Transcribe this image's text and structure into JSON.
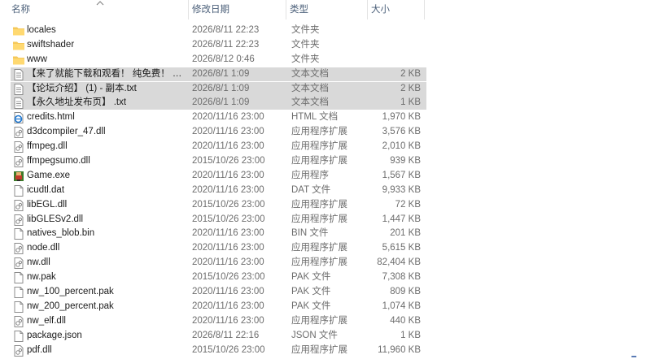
{
  "columns": {
    "name": "名称",
    "date": "修改日期",
    "type": "类型",
    "size": "大小"
  },
  "files": [
    {
      "name": "locales",
      "date": "2026/8/11 22:23",
      "type": "文件夹",
      "size": "",
      "icon": "folder-icon",
      "selected": false
    },
    {
      "name": "swiftshader",
      "date": "2026/8/11 22:23",
      "type": "文件夹",
      "size": "",
      "icon": "folder-icon",
      "selected": false
    },
    {
      "name": "www",
      "date": "2026/8/12 0:46",
      "type": "文件夹",
      "size": "",
      "icon": "folder-icon",
      "selected": false
    },
    {
      "name": "【来了就能下载和观看！ 纯免费！ 】 - 副...",
      "date": "2026/8/1 1:09",
      "type": "文本文档",
      "size": "2 KB",
      "icon": "text-document-icon",
      "selected": true
    },
    {
      "name": "【论坛介绍】 (1) - 副本.txt",
      "date": "2026/8/1 1:09",
      "type": "文本文档",
      "size": "2 KB",
      "icon": "text-document-icon",
      "selected": true
    },
    {
      "name": "【永久地址发布页】 .txt",
      "date": "2026/8/1 1:09",
      "type": "文本文档",
      "size": "1 KB",
      "icon": "text-document-icon",
      "selected": true
    },
    {
      "name": "credits.html",
      "date": "2020/11/16 23:00",
      "type": "HTML 文档",
      "size": "1,970 KB",
      "icon": "browser-icon",
      "selected": false
    },
    {
      "name": "d3dcompiler_47.dll",
      "date": "2020/11/16 23:00",
      "type": "应用程序扩展",
      "size": "3,576 KB",
      "icon": "dll-file-icon",
      "selected": false
    },
    {
      "name": "ffmpeg.dll",
      "date": "2020/11/16 23:00",
      "type": "应用程序扩展",
      "size": "2,010 KB",
      "icon": "dll-file-icon",
      "selected": false
    },
    {
      "name": "ffmpegsumo.dll",
      "date": "2015/10/26 23:00",
      "type": "应用程序扩展",
      "size": "939 KB",
      "icon": "dll-file-icon",
      "selected": false
    },
    {
      "name": "Game.exe",
      "date": "2020/11/16 23:00",
      "type": "应用程序",
      "size": "1,567 KB",
      "icon": "game-app-icon",
      "selected": false
    },
    {
      "name": "icudtl.dat",
      "date": "2020/11/16 23:00",
      "type": "DAT 文件",
      "size": "9,933 KB",
      "icon": "blank-file-icon",
      "selected": false
    },
    {
      "name": "libEGL.dll",
      "date": "2015/10/26 23:00",
      "type": "应用程序扩展",
      "size": "72 KB",
      "icon": "dll-file-icon",
      "selected": false
    },
    {
      "name": "libGLESv2.dll",
      "date": "2015/10/26 23:00",
      "type": "应用程序扩展",
      "size": "1,447 KB",
      "icon": "dll-file-icon",
      "selected": false
    },
    {
      "name": "natives_blob.bin",
      "date": "2020/11/16 23:00",
      "type": "BIN 文件",
      "size": "201 KB",
      "icon": "blank-file-icon",
      "selected": false
    },
    {
      "name": "node.dll",
      "date": "2020/11/16 23:00",
      "type": "应用程序扩展",
      "size": "5,615 KB",
      "icon": "dll-file-icon",
      "selected": false
    },
    {
      "name": "nw.dll",
      "date": "2020/11/16 23:00",
      "type": "应用程序扩展",
      "size": "82,404 KB",
      "icon": "dll-file-icon",
      "selected": false
    },
    {
      "name": "nw.pak",
      "date": "2015/10/26 23:00",
      "type": "PAK 文件",
      "size": "7,308 KB",
      "icon": "blank-file-icon",
      "selected": false
    },
    {
      "name": "nw_100_percent.pak",
      "date": "2020/11/16 23:00",
      "type": "PAK 文件",
      "size": "809 KB",
      "icon": "blank-file-icon",
      "selected": false
    },
    {
      "name": "nw_200_percent.pak",
      "date": "2020/11/16 23:00",
      "type": "PAK 文件",
      "size": "1,074 KB",
      "icon": "blank-file-icon",
      "selected": false
    },
    {
      "name": "nw_elf.dll",
      "date": "2020/11/16 23:00",
      "type": "应用程序扩展",
      "size": "440 KB",
      "icon": "dll-file-icon",
      "selected": false
    },
    {
      "name": "package.json",
      "date": "2026/8/11 22:16",
      "type": "JSON 文件",
      "size": "1 KB",
      "icon": "blank-file-icon",
      "selected": false
    },
    {
      "name": "pdf.dll",
      "date": "2015/10/26 23:00",
      "type": "应用程序扩展",
      "size": "11,960 KB",
      "icon": "dll-file-icon",
      "selected": false
    }
  ]
}
